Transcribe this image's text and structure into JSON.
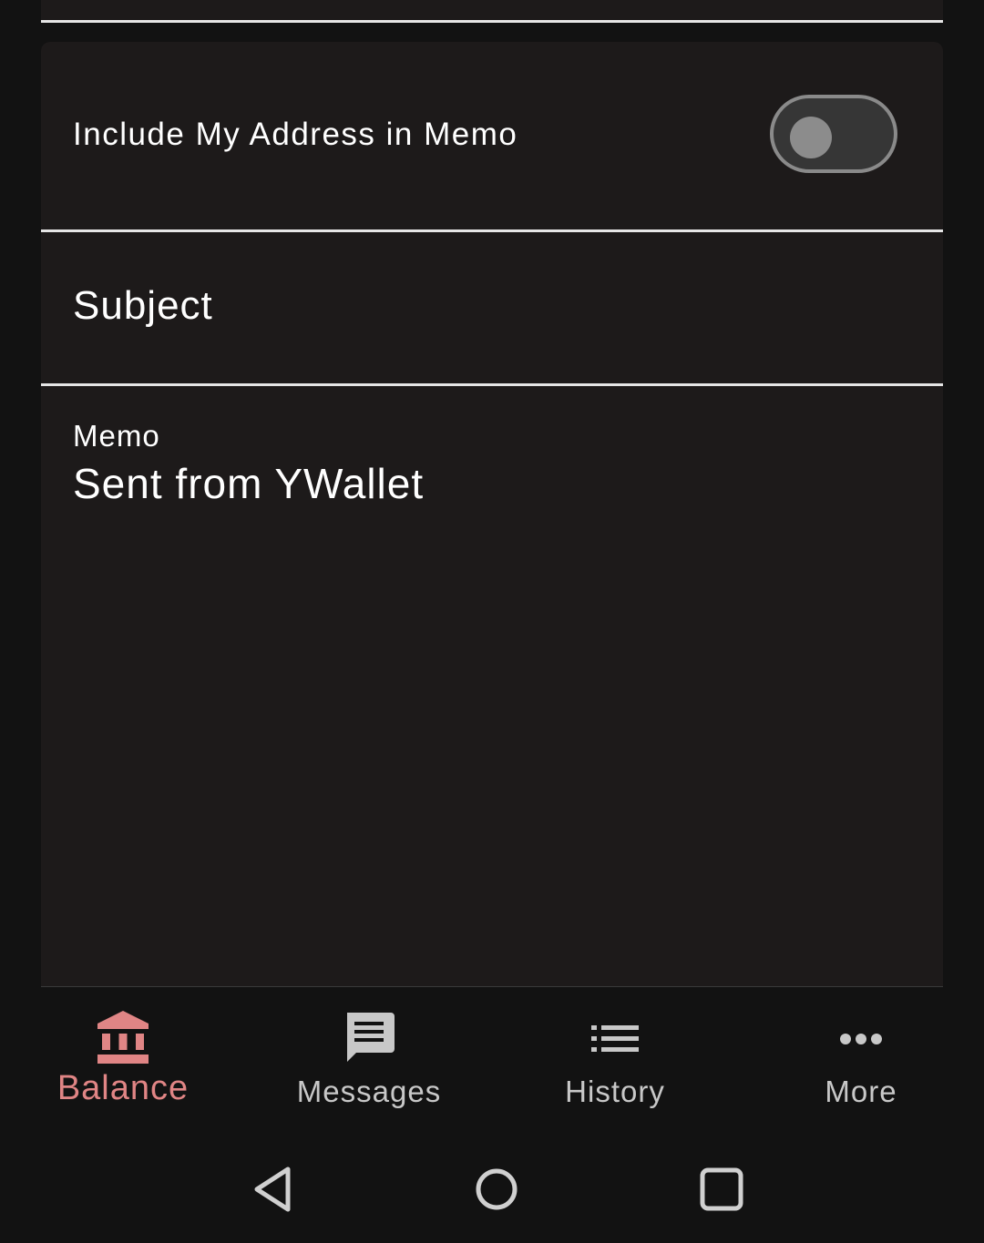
{
  "form": {
    "include_address_label": "Include My Address in Memo",
    "include_address_on": false,
    "subject_label": "Subject",
    "memo_label": "Memo",
    "memo_value": "Sent from YWallet"
  },
  "nav": {
    "items": [
      {
        "label": "Balance",
        "icon": "bank-icon",
        "active": true
      },
      {
        "label": "Messages",
        "icon": "message-icon",
        "active": false
      },
      {
        "label": "History",
        "icon": "list-icon",
        "active": false
      },
      {
        "label": "More",
        "icon": "more-horizontal-icon",
        "active": false
      }
    ]
  },
  "colors": {
    "background": "#121212",
    "surface": "#1d1a1a",
    "accent": "#e08585",
    "muted": "#c8c8c8"
  },
  "system_nav": {
    "icons": [
      "back-icon",
      "home-icon",
      "recents-icon"
    ]
  }
}
